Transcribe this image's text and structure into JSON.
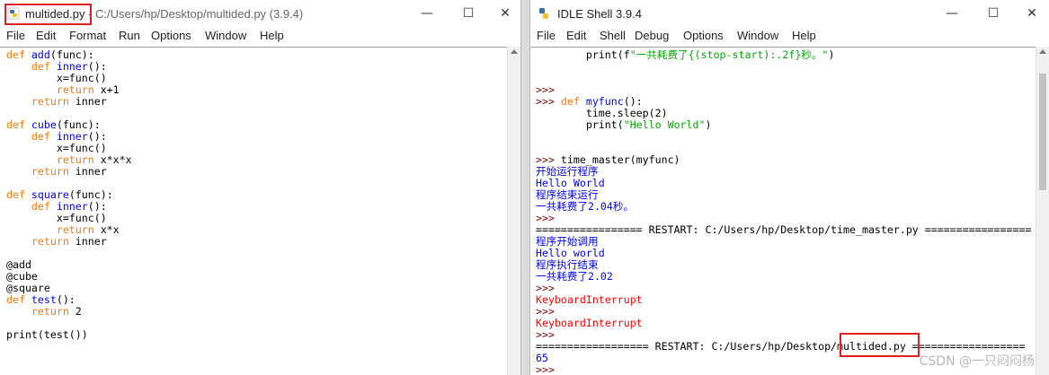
{
  "editor": {
    "title_file": "multided.py",
    "title_rest": " - C:/Users/hp/Desktop/multided.py (3.9.4)",
    "menu": [
      "File",
      "Edit",
      "Format",
      "Run",
      "Options",
      "Window",
      "Help"
    ],
    "code_lines": [
      [
        [
          "kw",
          "def "
        ],
        [
          "fn",
          "add"
        ],
        [
          "",
          "(func):"
        ]
      ],
      [
        [
          "kw",
          "    def "
        ],
        [
          "fn",
          "inner"
        ],
        [
          "",
          "():"
        ]
      ],
      [
        [
          "",
          "        x=func()"
        ]
      ],
      [
        [
          "kw",
          "        return "
        ],
        [
          "",
          "x+1"
        ]
      ],
      [
        [
          "kw",
          "    return "
        ],
        [
          "",
          "inner"
        ]
      ],
      [
        [
          "",
          ""
        ]
      ],
      [
        [
          "kw",
          "def "
        ],
        [
          "fn",
          "cube"
        ],
        [
          "",
          "(func):"
        ]
      ],
      [
        [
          "kw",
          "    def "
        ],
        [
          "fn",
          "inner"
        ],
        [
          "",
          "():"
        ]
      ],
      [
        [
          "",
          "        x=func()"
        ]
      ],
      [
        [
          "kw",
          "        return "
        ],
        [
          "",
          "x*x*x"
        ]
      ],
      [
        [
          "kw",
          "    return "
        ],
        [
          "",
          "inner"
        ]
      ],
      [
        [
          "",
          ""
        ]
      ],
      [
        [
          "kw",
          "def "
        ],
        [
          "fn",
          "square"
        ],
        [
          "",
          "(func):"
        ]
      ],
      [
        [
          "kw",
          "    def "
        ],
        [
          "fn",
          "inner"
        ],
        [
          "",
          "():"
        ]
      ],
      [
        [
          "",
          "        x=func()"
        ]
      ],
      [
        [
          "kw",
          "        return "
        ],
        [
          "",
          "x*x"
        ]
      ],
      [
        [
          "kw",
          "    return "
        ],
        [
          "",
          "inner"
        ]
      ],
      [
        [
          "",
          ""
        ]
      ],
      [
        [
          "",
          "@add"
        ]
      ],
      [
        [
          "",
          "@cube"
        ]
      ],
      [
        [
          "",
          "@square"
        ]
      ],
      [
        [
          "kw",
          "def "
        ],
        [
          "fn",
          "test"
        ],
        [
          "",
          "():"
        ]
      ],
      [
        [
          "kw",
          "    return "
        ],
        [
          "",
          "2"
        ]
      ],
      [
        [
          "",
          ""
        ]
      ],
      [
        [
          "",
          "print(test())"
        ]
      ]
    ]
  },
  "shell": {
    "title": "IDLE Shell 3.9.4",
    "menu": [
      "File",
      "Edit",
      "Shell",
      "Debug",
      "Options",
      "Window",
      "Help"
    ],
    "lines": [
      [
        [
          "",
          "        print(f"
        ],
        [
          "str",
          "\"一共耗费了{(stop-start):.2f}秒。\""
        ],
        [
          "",
          ")"
        ]
      ],
      [
        [
          "",
          ""
        ]
      ],
      [
        [
          "",
          ""
        ]
      ],
      [
        [
          "prompt",
          ">>>"
        ]
      ],
      [
        [
          "prompt",
          ">>> "
        ],
        [
          "kw",
          "def "
        ],
        [
          "fn",
          "myfunc"
        ],
        [
          "",
          "():"
        ]
      ],
      [
        [
          "",
          "        time.sleep(2)"
        ]
      ],
      [
        [
          "",
          "        print("
        ],
        [
          "str",
          "\"Hello World\""
        ],
        [
          "",
          ")"
        ]
      ],
      [
        [
          "",
          ""
        ]
      ],
      [
        [
          "",
          ""
        ]
      ],
      [
        [
          "prompt",
          ">>> "
        ],
        [
          "",
          "time_master(myfunc)"
        ]
      ],
      [
        [
          "out",
          "开始运行程序"
        ]
      ],
      [
        [
          "out",
          "Hello World"
        ]
      ],
      [
        [
          "out",
          "程序结束运行"
        ]
      ],
      [
        [
          "out",
          "一共耗费了2.04秒。"
        ]
      ],
      [
        [
          "prompt",
          ">>>"
        ]
      ],
      [
        [
          "",
          "================= RESTART: C:/Users/hp/Desktop/time_master.py ================="
        ]
      ],
      [
        [
          "out",
          "程序开始调用"
        ]
      ],
      [
        [
          "out",
          "Hello world"
        ]
      ],
      [
        [
          "out",
          "程序执行结束"
        ]
      ],
      [
        [
          "out",
          "一共耗费了2.02"
        ]
      ],
      [
        [
          "prompt",
          ">>>"
        ]
      ],
      [
        [
          "err",
          "KeyboardInterrupt"
        ]
      ],
      [
        [
          "prompt",
          ">>>"
        ]
      ],
      [
        [
          "err",
          "KeyboardInterrupt"
        ]
      ],
      [
        [
          "prompt",
          ">>>"
        ]
      ],
      [
        [
          "",
          "================== RESTART: C:/Users/hp/Desktop/multided.py =================="
        ]
      ],
      [
        [
          "out",
          "65"
        ]
      ],
      [
        [
          "prompt",
          ">>>"
        ]
      ]
    ]
  },
  "window_controls": {
    "minimize": "—",
    "maximize": "☐",
    "close": "✕"
  },
  "watermark": "CSDN @一只闷闷杨",
  "colors": {
    "keyword": "#ff7700",
    "defname": "#0000ff",
    "string": "#00aa00",
    "output": "#0000ff",
    "error": "#ff0000",
    "prompt": "#7f0000",
    "highlight": "#e02020"
  }
}
